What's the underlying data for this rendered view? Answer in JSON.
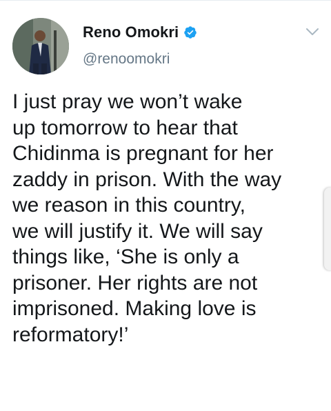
{
  "tweet": {
    "author": {
      "display_name": "Reno Omokri",
      "handle": "@renoomokri",
      "verified": true,
      "verified_icon": "verified-badge-icon",
      "avatar": "profile-photo"
    },
    "more_icon": "chevron-down-icon",
    "text": "I just pray we won’t wake\nup tomorrow to hear that\nChidinma is pregnant for her\nzaddy in prison. With the way\nwe reason in this country,\nwe will justify it. We will say\nthings like, ‘She is only a\nprisoner. Her rights are not\nimprisoned. Making love is\nreformatory!’"
  },
  "colors": {
    "text_primary": "#14171a",
    "text_secondary": "#657786",
    "verified_blue": "#1da1f2",
    "chevron_gray": "#aab8c2"
  }
}
